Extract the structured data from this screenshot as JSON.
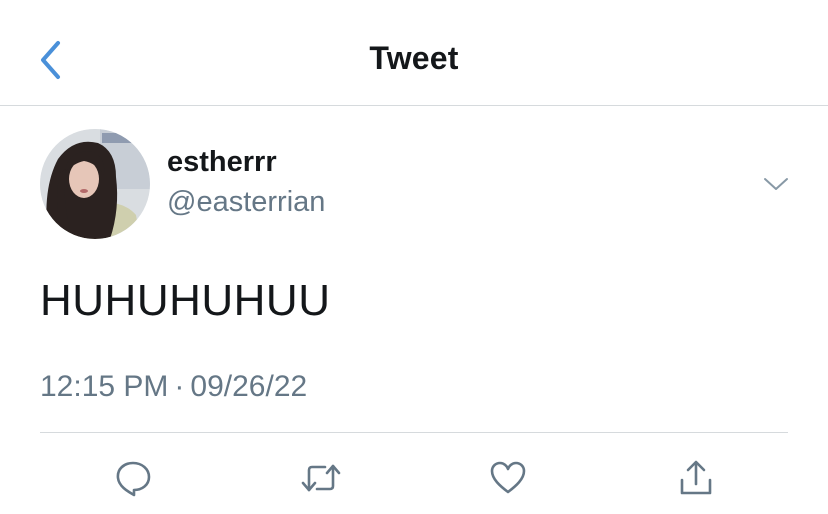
{
  "header": {
    "title": "Tweet",
    "back_icon": "chevron-left-icon",
    "accent_color": "#4a90d9"
  },
  "author": {
    "display_name": "estherrr",
    "handle": "@easterrian",
    "avatar_icon": "profile-photo"
  },
  "tweet": {
    "text": "HUHUHUHUU",
    "time": "12:15 PM",
    "separator": "·",
    "date": "09/26/22"
  },
  "actions": [
    {
      "name": "reply",
      "icon": "speech-bubble-icon"
    },
    {
      "name": "retweet",
      "icon": "retweet-arrows-icon"
    },
    {
      "name": "like",
      "icon": "heart-icon"
    },
    {
      "name": "share",
      "icon": "share-upload-icon"
    }
  ],
  "colors": {
    "text": "#14171a",
    "secondary_text": "#657786",
    "divider": "#d6dadd",
    "icon": "#657786"
  }
}
